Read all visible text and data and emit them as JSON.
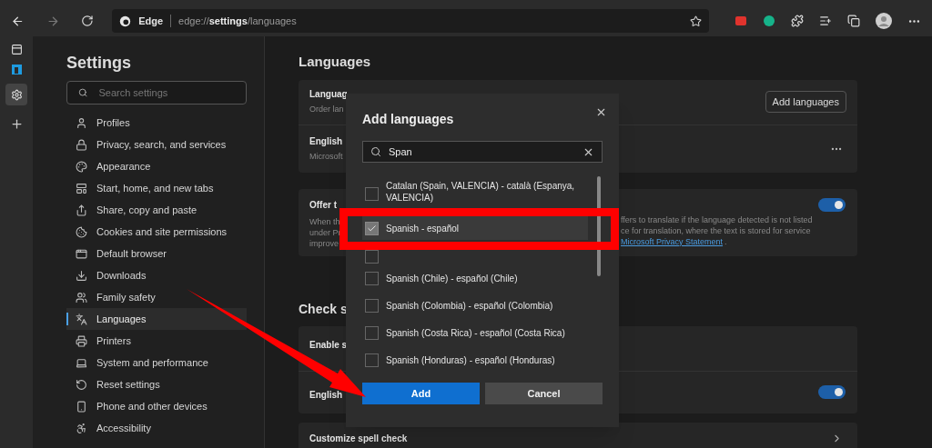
{
  "toolbar": {
    "brand": "Edge",
    "url_scheme": "edge://",
    "url_page": "settings",
    "url_path": "/languages"
  },
  "sidebar": {
    "title": "Settings",
    "search_placeholder": "Search settings",
    "items": [
      {
        "label": "Profiles",
        "selected": false
      },
      {
        "label": "Privacy, search, and services",
        "selected": false
      },
      {
        "label": "Appearance",
        "selected": false
      },
      {
        "label": "Start, home, and new tabs",
        "selected": false
      },
      {
        "label": "Share, copy and paste",
        "selected": false
      },
      {
        "label": "Cookies and site permissions",
        "selected": false
      },
      {
        "label": "Default browser",
        "selected": false
      },
      {
        "label": "Downloads",
        "selected": false
      },
      {
        "label": "Family safety",
        "selected": false
      },
      {
        "label": "Languages",
        "selected": true
      },
      {
        "label": "Printers",
        "selected": false
      },
      {
        "label": "System and performance",
        "selected": false
      },
      {
        "label": "Reset settings",
        "selected": false
      },
      {
        "label": "Phone and other devices",
        "selected": false
      },
      {
        "label": "Accessibility",
        "selected": false
      }
    ]
  },
  "main": {
    "heading": "Languages",
    "card_preferred": {
      "row1_title": "Languag",
      "row1_desc": "Order lan",
      "button": "Add languages",
      "row2_title": "English",
      "row2_desc": "Microsoft"
    },
    "card_translate": {
      "title": "Offer t",
      "desc_left": [
        "When th",
        "under Pr",
        "improve"
      ],
      "desc_right": [
        "ffers to translate if the language detected is not listed",
        "ce for translation, where the text is stored for service"
      ],
      "link": "Microsoft Privacy Statement",
      "link_after": ".",
      "on": true
    },
    "spell_heading": "Check s",
    "card_spell": {
      "row1_title": "Enable s",
      "row2_title": "English",
      "on": true
    },
    "customize": "Customize spell check"
  },
  "dialog": {
    "title": "Add languages",
    "search_value": "Span",
    "items": [
      {
        "label": "Catalan (Spain, VALENCIA) - català (Espanya, VALENCIA)",
        "checked": false
      },
      {
        "label": "Spanish - español",
        "checked": true
      },
      {
        "checked": false
      },
      {
        "label": "Spanish (Chile) - español (Chile)",
        "checked": false
      },
      {
        "label": "Spanish (Colombia) - español (Colombia)",
        "checked": false
      },
      {
        "label": "Spanish (Costa Rica) - español (Costa Rica)",
        "checked": false
      },
      {
        "label": "Spanish (Honduras) - español (Honduras)",
        "checked": false
      }
    ],
    "add": "Add",
    "cancel": "Cancel"
  }
}
